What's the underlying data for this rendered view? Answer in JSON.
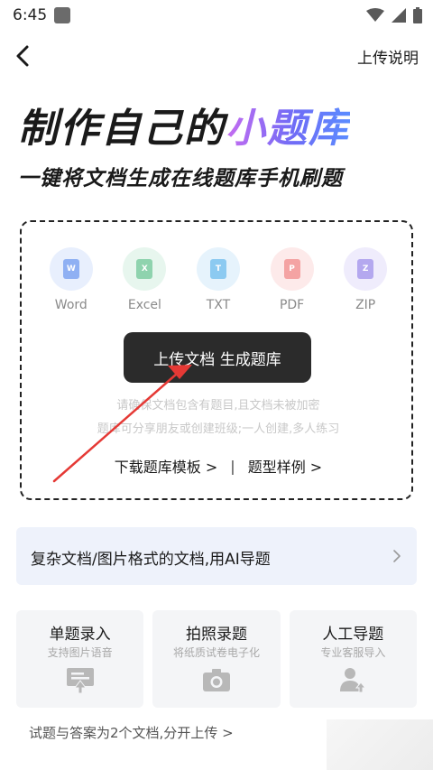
{
  "status_bar": {
    "time": "6:45",
    "icons": [
      "wifi-icon",
      "signal-icon",
      "battery-icon"
    ]
  },
  "nav": {
    "right_action": "上传说明"
  },
  "hero": {
    "title_main": "制作自己的",
    "title_accent": "小题库",
    "subtitle": "一键将文档生成在线题库手机刷题"
  },
  "file_types": [
    {
      "label": "Word",
      "letter": "W",
      "bg": "#e8effd",
      "fg": "#8fb0f3"
    },
    {
      "label": "Excel",
      "letter": "X",
      "bg": "#e7f6ee",
      "fg": "#8fd3ae"
    },
    {
      "label": "TXT",
      "letter": "T",
      "bg": "#e6f3fc",
      "fg": "#8ccaf1"
    },
    {
      "label": "PDF",
      "letter": "P",
      "bg": "#fdeaea",
      "fg": "#f4a3a3"
    },
    {
      "label": "ZIP",
      "letter": "Z",
      "bg": "#efecfc",
      "fg": "#b4a8ef"
    }
  ],
  "upload": {
    "button_label": "上传文档 生成题库",
    "hint_line1": "请确保文档包含有题目,且文档未被加密",
    "hint_line2": "题库可分享朋友或创建班级;一人创建,多人练习",
    "link_template": "下载题库模板 >",
    "link_separator": "|",
    "link_samples": "题型样例 >"
  },
  "ai_banner": {
    "text": "复杂文档/图片格式的文档,用AI导题"
  },
  "cards": [
    {
      "title": "单题录入",
      "subtitle": "支持图片语音",
      "icon": "single-entry-icon"
    },
    {
      "title": "拍照录题",
      "subtitle": "将纸质试卷电子化",
      "icon": "camera-icon"
    },
    {
      "title": "人工导题",
      "subtitle": "专业客服导入",
      "icon": "person-upload-icon"
    }
  ],
  "bottom_link": "试题与答案为2个文档,分开上传 >",
  "colors": {
    "accent_gradient_start": "#c56cf0",
    "accent_gradient_end": "#5b8cff",
    "button_bg": "#2b2b2b",
    "annotation_arrow": "#e53935",
    "banner_bg": "#eef2fb"
  }
}
